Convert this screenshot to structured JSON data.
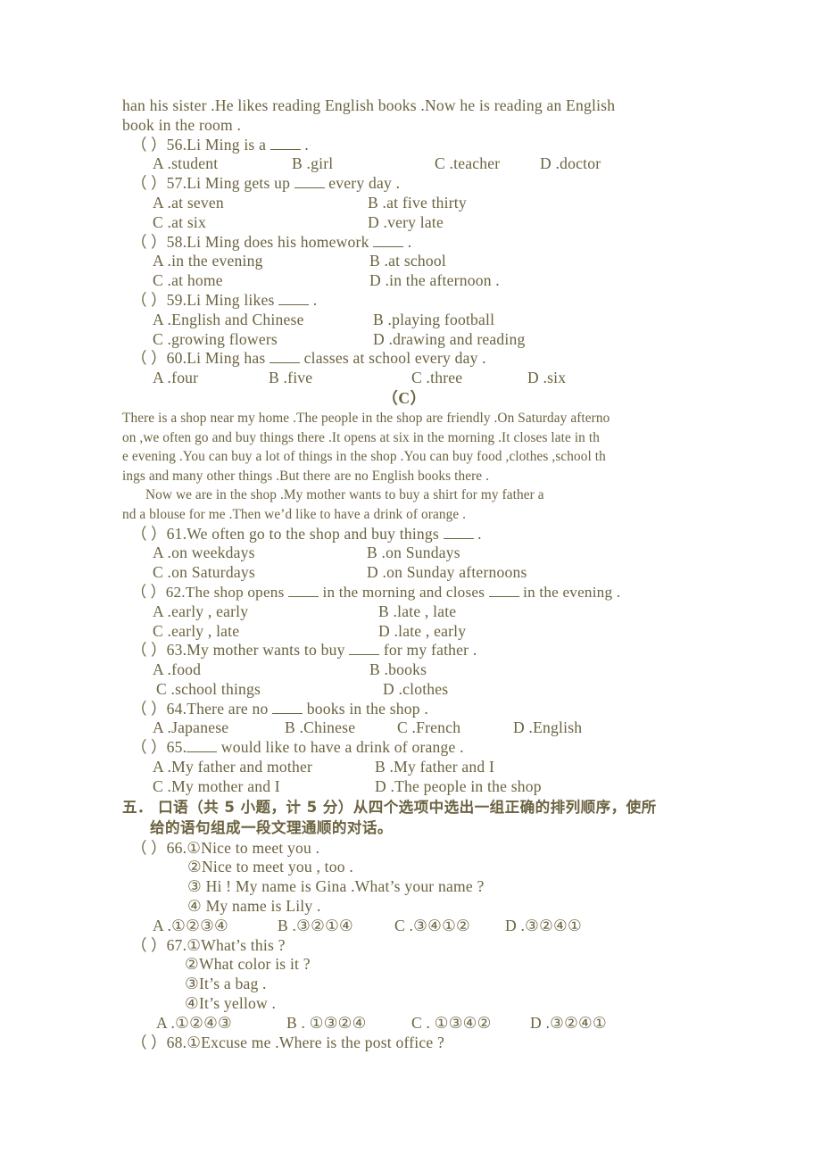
{
  "document": {
    "passage_b_tail": [
      "han his sister .He likes reading English books .Now he is reading an English",
      "book in the room ."
    ],
    "questions_56_60": [
      {
        "marker": "（  ）",
        "number": "56.",
        "stem_before": "Li Ming is a",
        "stem_after": ".",
        "options_rows": [
          [
            "A .student",
            "B .girl",
            "C .teacher",
            "D .doctor"
          ]
        ]
      },
      {
        "marker": "（  ）",
        "number": "57.",
        "stem_before": "Li Ming gets up",
        "stem_after": "every day .",
        "options_rows": [
          [
            "A .at seven",
            "B .at five thirty"
          ],
          [
            "C .at six",
            "D .very late"
          ]
        ]
      },
      {
        "marker": "（  ）",
        "number": "58.",
        "stem_before": "Li Ming does his homework",
        "stem_after": ".",
        "options_rows": [
          [
            "A .in the evening",
            "B .at school"
          ],
          [
            "C .at home",
            "D .in the afternoon ."
          ]
        ]
      },
      {
        "marker": "（  ）",
        "number": "59.",
        "stem_before": "Li Ming likes",
        "stem_after": ".",
        "options_rows": [
          [
            "A .English and Chinese",
            "B .playing football"
          ],
          [
            "C .growing flowers",
            "D .drawing and reading"
          ]
        ]
      },
      {
        "marker": "（  ）",
        "number": "60.",
        "stem_before": "Li Ming has",
        "stem_after": "classes at school every day .",
        "options_rows": [
          [
            "A .four",
            "B .five",
            "C .three",
            "D .six"
          ]
        ]
      }
    ],
    "section_c_heading": "（C）",
    "passage_c": [
      "There is a shop near my home .The people in the shop are friendly .On Saturday afterno",
      "on ,we often go and buy things there .It opens at six in the morning .It closes late in th",
      "e evening .You can buy a lot of things in the shop .You can buy food ,clothes ,school th",
      "ings and  many other things .But there are no English books there .",
      "Now we are in the shop .My mother wants to buy a shirt for my father a",
      "nd a blouse for me .Then we’d like to have a drink of orange ."
    ],
    "questions_61_65": [
      {
        "marker": "（  ）",
        "number": "61.",
        "stem_before": "We often go to the shop and buy things",
        "stem_after": ".",
        "options_rows": [
          [
            "A .on weekdays",
            "B .on Sundays"
          ],
          [
            "C .on Saturdays",
            "D .on Sunday afternoons"
          ]
        ]
      },
      {
        "marker": "（  ）",
        "number": "62.",
        "stem_before": "The shop opens",
        "stem_mid": "in the morning and closes",
        "stem_after": "in the evening .",
        "options_rows": [
          [
            "A .early , early",
            "B .late , late"
          ],
          [
            "C .early , late",
            "D .late , early"
          ]
        ]
      },
      {
        "marker": "（  ）",
        "number": "63.",
        "stem_before": "My mother wants to buy",
        "stem_after": "for my father .",
        "options_rows": [
          [
            "A .food",
            "B .books"
          ],
          [
            "C .school things",
            "D .clothes"
          ]
        ]
      },
      {
        "marker": "（  ）",
        "number": "64.",
        "stem_before": "There are no",
        "stem_after": "books in the shop .",
        "options_rows": [
          [
            "A .Japanese",
            "B .Chinese",
            "C .French",
            "D .English"
          ]
        ]
      },
      {
        "marker": "（  ）",
        "number": "65.",
        "stem_before": "",
        "stem_after": "would like to have a drink of orange .",
        "options_rows": [
          [
            "A .My father and mother",
            "B .My father and I"
          ],
          [
            "C .My mother and I",
            "D .The people in the shop"
          ]
        ]
      }
    ],
    "section_five": {
      "line1": "五．  口语（共 5 小题，计 5 分）从四个选项中选出一组正确的排列顺序，使所",
      "line2": "给的语句组成一段文理通顺的对话。"
    },
    "questions_66_68": [
      {
        "marker": "（  ）",
        "number": "66.",
        "first_item": "①Nice to meet you .",
        "items": [
          "②Nice to meet you , too .",
          "③ Hi ! My name is Gina .What’s your name ?",
          "④ My name is Lily ."
        ],
        "answers": [
          "A .①②③④",
          "B .③②①④",
          "C .③④①②",
          "D .③②④①"
        ]
      },
      {
        "marker": "（  ）",
        "number": "67.",
        "first_item": "①What’s this ?",
        "items": [
          "②What color is it ?",
          "③It’s a bag .",
          "④It’s yellow ."
        ],
        "answers": [
          "A .①②④③",
          "B . ①③②④",
          "C . ①③④②",
          "D .③②④①"
        ]
      },
      {
        "marker": "（  ）",
        "number": "68.",
        "first_item": "①Excuse me .Where is the post office ?",
        "items": [],
        "answers": []
      }
    ]
  },
  "colors": {
    "text": "#6b6340",
    "background": "#ffffff"
  }
}
